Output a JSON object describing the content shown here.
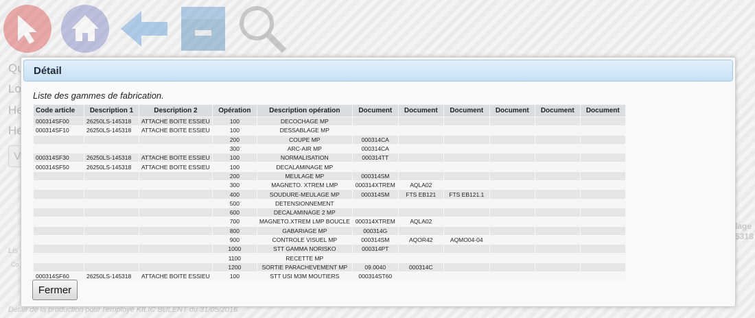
{
  "background": {
    "labels": [
      "Qu",
      "Lo",
      "He",
      "He"
    ],
    "box_text": "V",
    "list_caption": "Lis",
    "col_stub": "Co",
    "right_num": "6",
    "right_header": "lage",
    "right_value": "5318",
    "footer_text": "Détail de la production pour l'employé KILIC BULENT du 31/05/2016."
  },
  "modal": {
    "title": "Détail",
    "caption": "Liste des gammes de fabrication.",
    "close_label": "Fermer"
  },
  "table": {
    "headers": [
      "Code article",
      "Description 1",
      "Description 2",
      "Opération",
      "Description opération",
      "Document",
      "Document",
      "Document",
      "Document",
      "Document",
      "Document"
    ],
    "rows": [
      [
        "000314SF00",
        "26250LS-145318",
        "ATTACHE BOITE ESSIEU",
        "100",
        "DECOCHAGE MP",
        "",
        "",
        "",
        "",
        "",
        ""
      ],
      [
        "000314SF10",
        "26250LS-145318",
        "ATTACHE BOITE ESSIEU",
        "100",
        "DESSABLAGE MP",
        "",
        "",
        "",
        "",
        "",
        ""
      ],
      [
        "",
        "",
        "",
        "200",
        "COUPE MP",
        "000314CA",
        "",
        "",
        "",
        "",
        ""
      ],
      [
        "",
        "",
        "",
        "300",
        "ARC-AIR MP",
        "000314CA",
        "",
        "",
        "",
        "",
        ""
      ],
      [
        "000314SF30",
        "26250LS-145318",
        "ATTACHE BOITE ESSIEU",
        "100",
        "NORMALISATION",
        "000314TT",
        "",
        "",
        "",
        "",
        ""
      ],
      [
        "000314SF50",
        "26250LS-145318",
        "ATTACHE BOITE ESSIEU",
        "100",
        "DECALAMINAGE MP",
        "",
        "",
        "",
        "",
        "",
        ""
      ],
      [
        "",
        "",
        "",
        "200",
        "MEULAGE MP",
        "000314SM",
        "",
        "",
        "",
        "",
        ""
      ],
      [
        "",
        "",
        "",
        "300",
        "MAGNETO. XTREM LMP",
        "000314XTREM",
        "AQLA02",
        "",
        "",
        "",
        ""
      ],
      [
        "",
        "",
        "",
        "400",
        "SOUDURE-MEULAGE MP",
        "000314SM",
        "FTS EB121",
        "FTS EB121.1",
        "",
        "",
        ""
      ],
      [
        "",
        "",
        "",
        "500",
        "DETENSIONNEMENT",
        "",
        "",
        "",
        "",
        "",
        ""
      ],
      [
        "",
        "",
        "",
        "600",
        "DECALAMINAGE 2 MP",
        "",
        "",
        "",
        "",
        "",
        ""
      ],
      [
        "",
        "",
        "",
        "700",
        "MAGNETO.XTREM LMP BOUCLE",
        "000314XTREM",
        "AQLA02",
        "",
        "",
        "",
        ""
      ],
      [
        "",
        "",
        "",
        "800",
        "GABARIAGE MP",
        "000314G",
        "",
        "",
        "",
        "",
        ""
      ],
      [
        "",
        "",
        "",
        "900",
        "CONTROLE VISUEL MP",
        "000314SM",
        "AQOR42",
        "AQMO04-04",
        "",
        "",
        ""
      ],
      [
        "",
        "",
        "",
        "1000",
        "STT GAMMA NORISKO",
        "000314PT",
        "",
        "",
        "",
        "",
        ""
      ],
      [
        "",
        "",
        "",
        "1100",
        "RECETTE MP",
        "",
        "",
        "",
        "",
        "",
        ""
      ],
      [
        "",
        "",
        "",
        "1200",
        "SORTIE PARACHEVEMENT MP",
        "09.0040",
        "000314C",
        "",
        "",
        "",
        ""
      ],
      [
        "000314SF60",
        "26250LS-145318",
        "ATTACHE BOITE ESSIEU",
        "100",
        "STT USI M3M MOUTIERS",
        "000314ST60",
        "",
        "",
        "",
        "",
        ""
      ]
    ]
  }
}
